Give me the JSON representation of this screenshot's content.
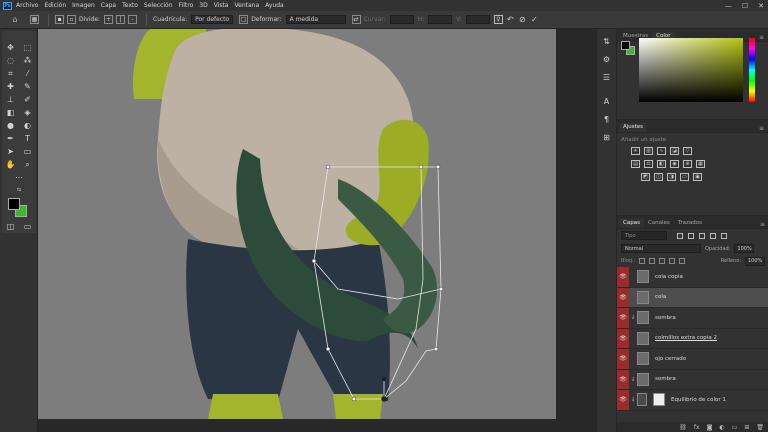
{
  "app": {
    "logo": "Ps"
  },
  "menubar": {
    "items": [
      "Archivo",
      "Edición",
      "Imagen",
      "Capa",
      "Texto",
      "Selección",
      "Filtro",
      "3D",
      "Vista",
      "Ventana",
      "Ayuda"
    ]
  },
  "window": {
    "minimize": "—",
    "maximize": "☐",
    "close": "✕"
  },
  "options_bar": {
    "divide_label": "Divide:",
    "grid_label": "Cuadrícula:",
    "grid_value": "Por defecto",
    "deform_label": "Deformar:",
    "deform_value": "A medida",
    "curve_label": "Curvar:",
    "h_label": "H:",
    "v_label": "V:"
  },
  "colors": {
    "accent": "#31a8ff",
    "visibility": "#9b2a2a",
    "foreground": "#000000",
    "background": "#3bb82d"
  },
  "panels": {
    "color_tabs": [
      "Muestras",
      "Color"
    ],
    "adjust_tab": "Ajustes",
    "adjust_hint": "Añadir un ajuste"
  },
  "layers_panel": {
    "tabs": [
      "Capas",
      "Canales",
      "Trazados"
    ],
    "search_placeholder": "Tipo",
    "blend_mode": "Normal",
    "opacity_label": "Opacidad:",
    "opacity_value": "100%",
    "lock_label": "Bloq.:",
    "fill_label": "Relleno:",
    "fill_value": "100%",
    "layers": [
      {
        "name": "cola copia",
        "clipped": false,
        "selected": false,
        "underline": false
      },
      {
        "name": "cola",
        "clipped": false,
        "selected": true,
        "underline": false
      },
      {
        "name": "sombra",
        "clipped": true,
        "selected": false,
        "underline": false
      },
      {
        "name": "colmillos extra copia 2",
        "clipped": false,
        "selected": false,
        "underline": true
      },
      {
        "name": "ojo cerrado",
        "clipped": false,
        "selected": false,
        "underline": false
      },
      {
        "name": "sombra",
        "clipped": true,
        "selected": false,
        "underline": false
      },
      {
        "name": "Equilibrio de color 1",
        "clipped": true,
        "selected": false,
        "underline": false
      }
    ]
  }
}
